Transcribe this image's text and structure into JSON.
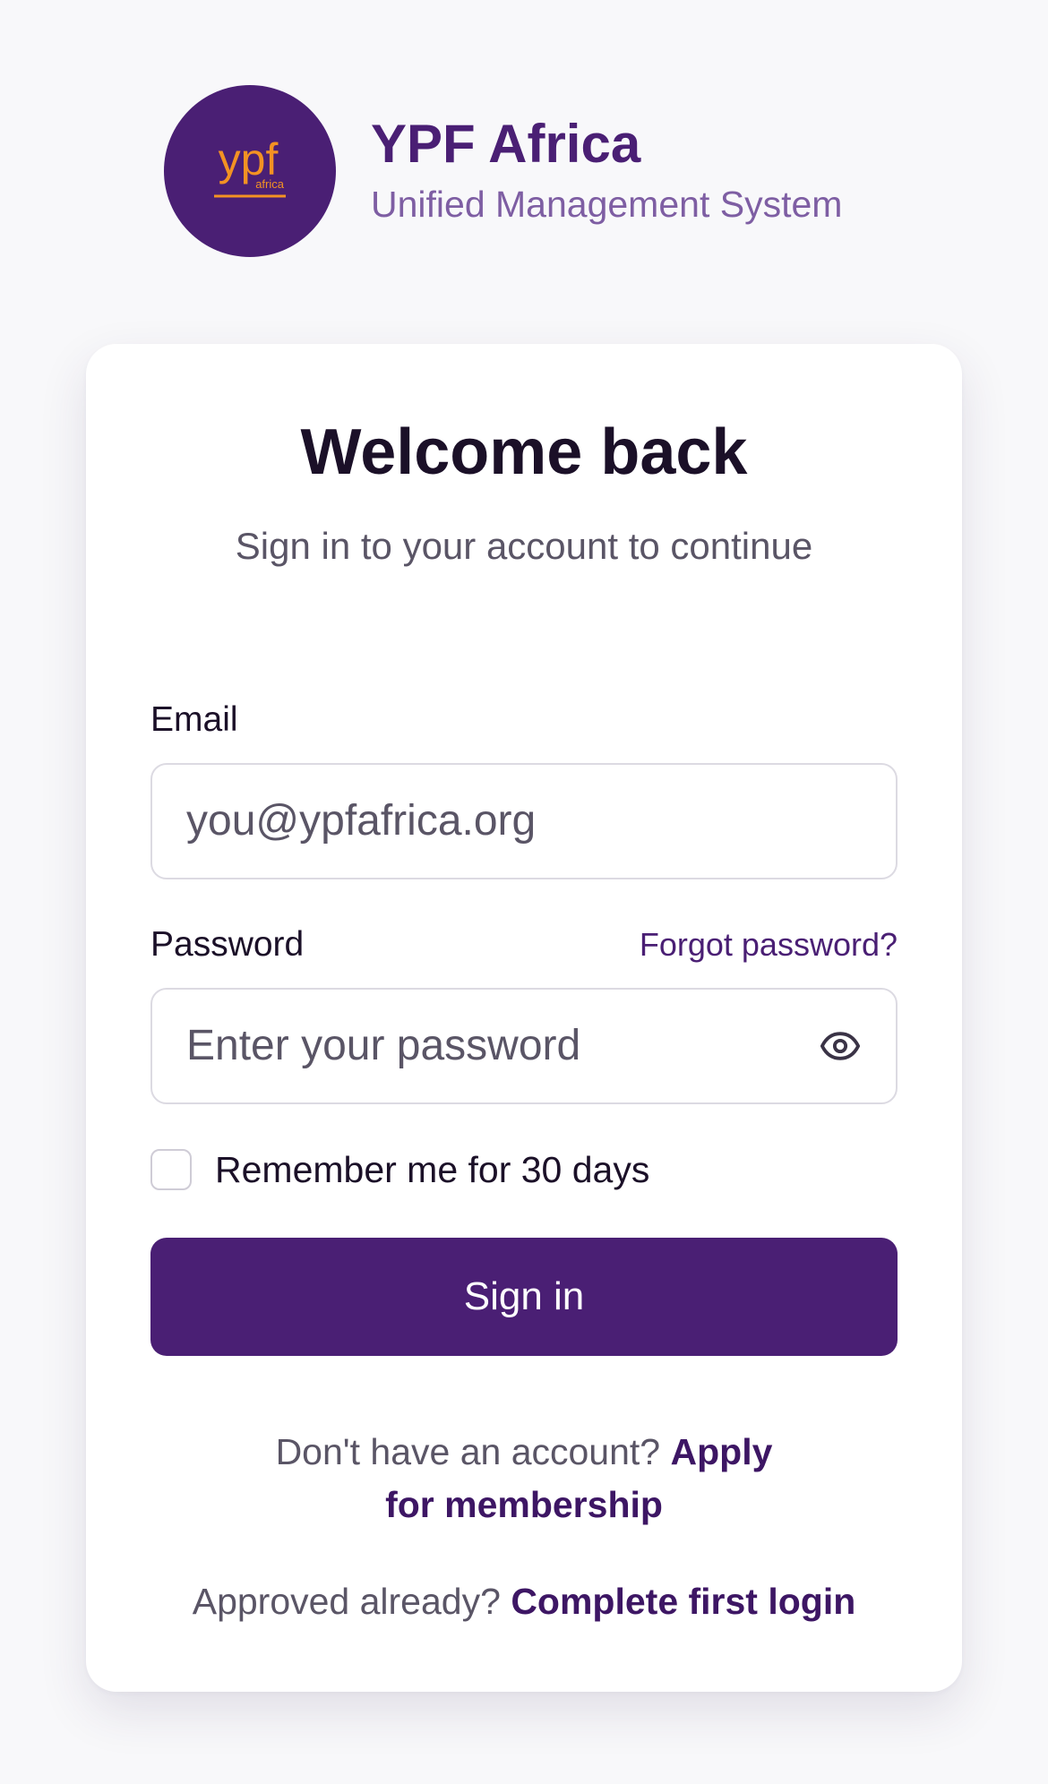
{
  "brand": {
    "logo_text": "ypf",
    "logo_subtext": "africa",
    "title": "YPF Africa",
    "subtitle": "Unified Management System"
  },
  "colors": {
    "primary": "#4a1f74",
    "accent": "#f39223",
    "background": "#f8f8fa"
  },
  "login": {
    "title": "Welcome back",
    "subtitle": "Sign in to your account to continue",
    "email": {
      "label": "Email",
      "placeholder": "you@ypfafrica.org",
      "value": ""
    },
    "password": {
      "label": "Password",
      "placeholder": "Enter your password",
      "value": "",
      "forgot_label": "Forgot password?",
      "toggle_icon": "eye-icon"
    },
    "remember": {
      "label": "Remember me for 30 days",
      "checked": false
    },
    "submit_label": "Sign in",
    "signup_prompt": "Don't have an account?",
    "signup_link": "Apply for membership",
    "first_login_prompt": "Approved already?",
    "first_login_link": "Complete first login"
  }
}
